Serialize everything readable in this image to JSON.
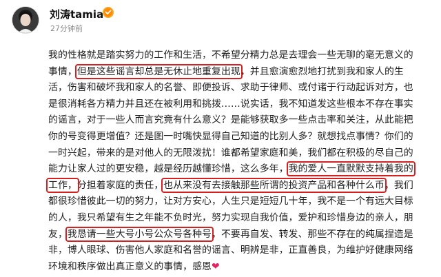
{
  "author": {
    "name": "刘涛tamia",
    "time": "27分钟前",
    "badge_icon": "verified-badge-icon"
  },
  "post": {
    "lines": [
      {
        "parts": [
          {
            "text": "我的性格就是踏实努力的工作和生活，不希望分精力总是去理会一些无聊的毫无意义的"
          }
        ]
      },
      {
        "parts": [
          {
            "text": "事情，"
          },
          {
            "text": "但是这些谣言却总是无休止地重复出现",
            "hl": true
          },
          {
            "text": "，并且愈演愈烈地打扰到我和家人的生"
          }
        ]
      },
      {
        "parts": [
          {
            "text": "活，伤害和破坏我和家人的名誉、即便投诉、求助于律师、或付诸于行动起诉对方，也"
          }
        ]
      },
      {
        "parts": [
          {
            "text": "是很消耗各方精力并且还在被利用和挑拨……说实话，我不知道发这些根本不存在事实"
          }
        ]
      },
      {
        "parts": [
          {
            "text": "的谣言，对于一些人而言究竟有什么意义？是能够获取多一些点击率和关注，从此能把"
          }
        ]
      },
      {
        "parts": [
          {
            "text": "你的号变得更增值？还是图一时嘴快显得自己知道的比别人多？就想找点事情？你们的"
          }
        ]
      },
      {
        "parts": [
          {
            "text": "一时兴起，带来的是对他人的无限泼扰！谁都希望家庭和美，我们都在积极的尽自己的"
          }
        ]
      },
      {
        "parts": [
          {
            "text": "能力让家人过的更安稳，越是经历越懂珍惜，这么多年，"
          },
          {
            "text": "我的爱人一直默默支持着我的",
            "hl": true
          }
        ]
      },
      {
        "parts": [
          {
            "text": "工作，",
            "hl": true
          },
          {
            "text": "分担着家庭的责任，"
          },
          {
            "text": "也从来没有去接触那些所谓的投资产品和各种什么币",
            "hl": true
          },
          {
            "text": "，我们"
          }
        ]
      },
      {
        "parts": [
          {
            "text": "都很珍惜彼此一切的努力，让对方安心，人生只是短短几十年，我不是一个有远大目标"
          }
        ]
      },
      {
        "parts": [
          {
            "text": "的人，我只希望有生之年能不负时光，努力实现自我价值，爱护和珍惜身边的亲人，朋"
          }
        ]
      },
      {
        "parts": [
          {
            "text": "友，"
          },
          {
            "text": "我恳请一些大号小号公众号各种号",
            "hl": true
          },
          {
            "text": "，不要再自发、转发、那些不存在的纯属捏造是"
          }
        ]
      },
      {
        "parts": [
          {
            "text": "非，博人眼球、伤害他人家庭和名誉的谣言、明辨是非，正直善良，为维护好健康网络"
          }
        ]
      },
      {
        "parts": [
          {
            "text": "环境和秩序做出真正意义的事情，感恩"
          },
          {
            "text": "❤",
            "heart": true
          }
        ]
      }
    ]
  }
}
